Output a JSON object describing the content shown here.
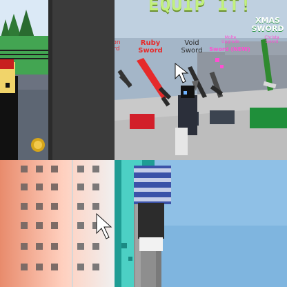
{
  "panels": {
    "top_right": {
      "banner": "EQUIP IT!",
      "labels": {
        "left_partial": "on\nrd",
        "ruby": "Ruby\nSword",
        "void": "Void\nSword",
        "sword_new": "Sword (NEW)",
        "xmas": "XMAS\nSWORD",
        "tiny_left": "Molte\nUpgrade",
        "tiny_right": "Christa\nSword"
      },
      "colors": {
        "banner": "#c2f07e",
        "ruby": "#e62a2a",
        "void": "#333333",
        "xmas": "#ffffff",
        "pink": "#ff4dd2"
      }
    }
  }
}
